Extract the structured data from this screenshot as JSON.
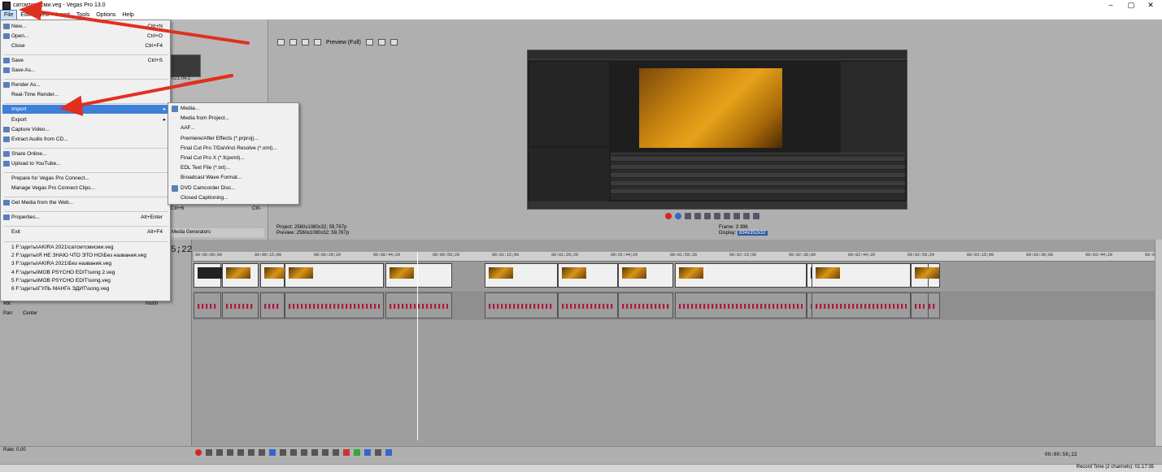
{
  "window": {
    "title": "сатсмтсмисми.veg - Vegas Pro 13.0",
    "controls": [
      "–",
      "▢",
      "✕"
    ]
  },
  "menubar": [
    "File",
    "Edit",
    "View",
    "Insert",
    "Tools",
    "Options",
    "Help"
  ],
  "file_menu": {
    "items": [
      {
        "label": "New...",
        "shortcut": "Ctrl+N",
        "icon": "new-file-icon"
      },
      {
        "label": "Open...",
        "shortcut": "Ctrl+O",
        "icon": "open-folder-icon"
      },
      {
        "label": "Close",
        "shortcut": "Ctrl+F4"
      },
      {
        "label": "Save",
        "shortcut": "Ctrl+S",
        "icon": "save-icon"
      },
      {
        "label": "Save As...",
        "shortcut": "",
        "icon": "save-as-icon"
      },
      {
        "label": "Render As...",
        "shortcut": "",
        "icon": "render-icon"
      },
      {
        "label": "Real-Time Render...",
        "shortcut": ""
      },
      {
        "label": "Import",
        "shortcut": "",
        "submenu": true
      },
      {
        "label": "Export",
        "shortcut": "",
        "submenu": true
      },
      {
        "label": "Capture Video...",
        "shortcut": "",
        "icon": "capture-icon"
      },
      {
        "label": "Extract Audio from CD...",
        "shortcut": "",
        "icon": "cd-icon"
      },
      {
        "label": "Share Online...",
        "shortcut": "",
        "icon": "share-icon"
      },
      {
        "label": "Upload to YouTube...",
        "shortcut": "",
        "icon": "youtube-icon"
      },
      {
        "label": "Prepare for Vegas Pro Connect...",
        "shortcut": ""
      },
      {
        "label": "Manage Vegas Pro Connect Clips...",
        "shortcut": ""
      },
      {
        "label": "Get Media from the Web...",
        "shortcut": "",
        "icon": "web-icon"
      },
      {
        "label": "Properties...",
        "shortcut": "Alt+Enter",
        "icon": "properties-icon"
      },
      {
        "label": "Exit",
        "shortcut": "Alt+F4"
      }
    ],
    "recent": [
      "1 F:\\эдиты\\AKIRA 2021\\сатсмтсмисми.veg",
      "2 F:\\эдиты\\Я НЕ ЗНАЮ ЧТО ЭТО НО\\Без названия.veg",
      "3 F:\\эдиты\\AKIRA 2021\\Без названия.veg",
      "4 F:\\эдиты\\MOB PSYCHO EDIT\\song 2.veg",
      "5 F:\\эдиты\\MOB PSYCHO EDIT\\song.veg",
      "6 F:\\эдиты\\ГУЛЬ МАНГА ЭДИТ\\song.veg"
    ]
  },
  "import_submenu": [
    {
      "label": "Media...",
      "icon": "media-icon"
    },
    {
      "label": "Media from Project...",
      "icon": ""
    },
    {
      "label": "AAF...",
      "icon": ""
    },
    {
      "label": "Premiere/After Effects (*.prproj)...",
      "icon": ""
    },
    {
      "label": "Final Cut Pro 7/DaVinci Resolve (*.xml)...",
      "icon": ""
    },
    {
      "label": "Final Cut Pro X (*.fcpxml)...",
      "icon": ""
    },
    {
      "label": "EDL Text File (*.txt)...",
      "icon": ""
    },
    {
      "label": "Broadcast Wave Format...",
      "icon": ""
    },
    {
      "label": "DVD Camcorder Disc...",
      "icon": "dvd-icon"
    },
    {
      "label": "Closed Captioning...",
      "icon": ""
    }
  ],
  "dock": {
    "media_thumb_caption": "021.04.1",
    "tab_label": "Media Generators",
    "ctrl_label": "Ctrl+6",
    "ctl_right": "Ctrl-"
  },
  "preview": {
    "mode_label": "Preview (Full)",
    "project_info": "Project:  2560x1080x32; 59,767p",
    "preview_info": "Preview:  2560x1080x32; 59,767p",
    "frame_label": "Frame:",
    "frame_value": "3 396",
    "display_label": "Display:",
    "display_value": "834x352x32"
  },
  "timeline": {
    "timecode": "5;22",
    "ticks": [
      "00:00:00;00",
      "00:00:15;00",
      "00:00:29;29",
      "00:00:44;29",
      "00:00:59;28",
      "00:01:15;00",
      "00:01:29;29",
      "00:01:44;29",
      "00:01:59;28",
      "00:02:15;00",
      "00:02:30;00",
      "00:02:44;29",
      "00:02:59;29",
      "00:03:15;00",
      "00:03:30;00",
      "00:03:44;29",
      "00:0"
    ],
    "vol_label": "Vol:",
    "pan_label": "Pan:",
    "pan_value": "Center",
    "touch_label": "Touch",
    "rate_label": "Rate: 0,00",
    "bottom_timecode": "00:00:56;22"
  },
  "status": {
    "record_time": "Record Time (2 channels): 01:17:35"
  }
}
